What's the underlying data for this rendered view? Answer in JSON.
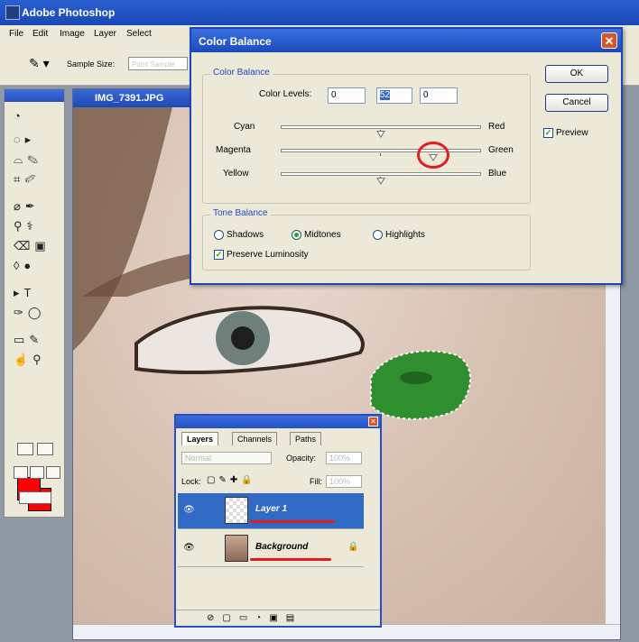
{
  "app": {
    "title": "Adobe Photoshop"
  },
  "menu": [
    "File",
    "Edit",
    "Image",
    "Layer",
    "Select"
  ],
  "options_bar": {
    "sample_size_label": "Sample Size:",
    "sample_size_value": "Point Sample"
  },
  "document": {
    "title": "IMG_7391.JPG"
  },
  "colors": {
    "foreground": "#ff0000",
    "background": "#ff0000",
    "selection": "#2f8f2f",
    "annotation": "#e31b1b"
  },
  "dialog": {
    "title": "Color Balance",
    "group_color_balance": "Color Balance",
    "color_levels_label": "Color Levels:",
    "levels": [
      "0",
      "52",
      "0"
    ],
    "sliders": [
      {
        "left": "Cyan",
        "right": "Red",
        "value": 0
      },
      {
        "left": "Magenta",
        "right": "Green",
        "value": 52
      },
      {
        "left": "Yellow",
        "right": "Blue",
        "value": 0
      }
    ],
    "group_tone_balance": "Tone Balance",
    "tone_options": [
      "Shadows",
      "Midtones",
      "Highlights"
    ],
    "tone_selected": "Midtones",
    "preserve_luminosity": "Preserve Luminosity",
    "ok": "OK",
    "cancel": "Cancel",
    "preview": "Preview"
  },
  "layers_panel": {
    "tabs": [
      "Layers",
      "Channels",
      "Paths"
    ],
    "blend_mode": "Normal",
    "opacity_label": "Opacity:",
    "opacity_value": "100%",
    "lock_label": "Lock:",
    "fill_label": "Fill:",
    "fill_value": "100%",
    "layers": [
      {
        "name": "Layer 1",
        "selected": true
      },
      {
        "name": "Background",
        "selected": false
      }
    ]
  }
}
